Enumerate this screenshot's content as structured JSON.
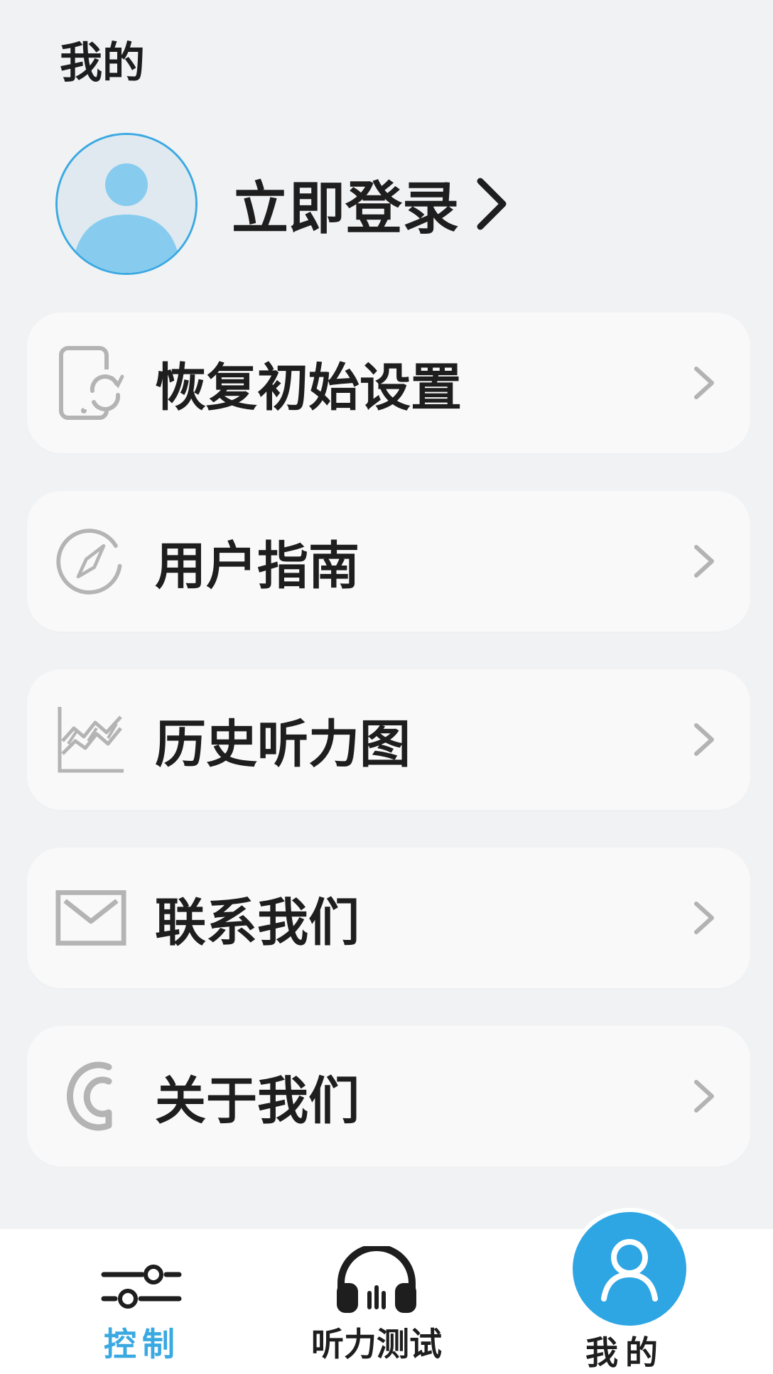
{
  "header": {
    "title": "我的"
  },
  "profile": {
    "login_label": "立即登录",
    "avatar_icon": "user-avatar-icon",
    "accent": "#3aa9e2"
  },
  "menu": [
    {
      "label": "恢复初始设置",
      "icon": "reset-device-icon"
    },
    {
      "label": "用户指南",
      "icon": "compass-icon"
    },
    {
      "label": "历史听力图",
      "icon": "chart-icon"
    },
    {
      "label": "联系我们",
      "icon": "mail-icon"
    },
    {
      "label": "关于我们",
      "icon": "about-logo-icon"
    }
  ],
  "tabbar": {
    "tabs": [
      {
        "label": "控制",
        "icon": "sliders-icon",
        "color": "#3aa9e2"
      },
      {
        "label": "听力测试",
        "icon": "headphones-icon",
        "color": "#1e1e1e"
      },
      {
        "label": "我的",
        "icon": "user-icon",
        "color": "#1e1e1e",
        "active": true
      }
    ]
  }
}
